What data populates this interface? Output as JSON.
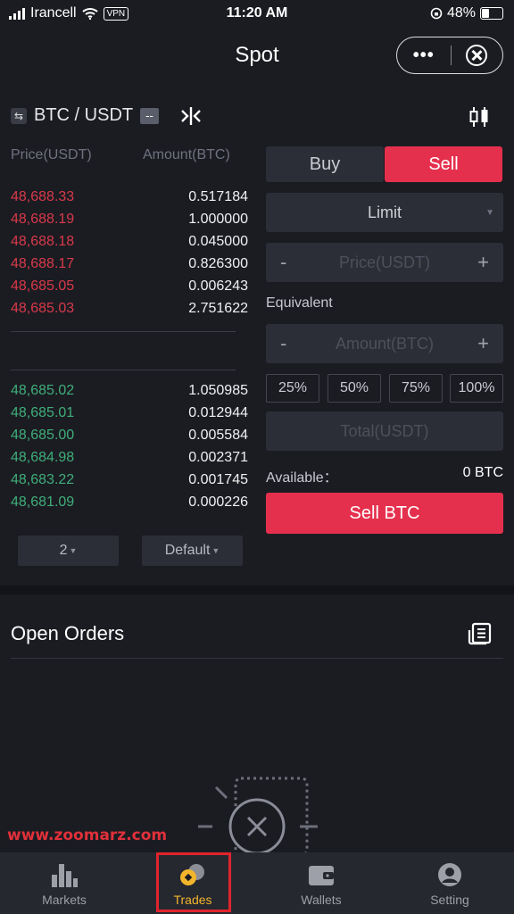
{
  "status_bar": {
    "carrier": "Irancell",
    "vpn": "VPN",
    "time": "11:20 AM",
    "battery": "48%"
  },
  "header": {
    "title": "Spot",
    "more_icon": "more-dots-icon",
    "close_icon": "close-circle-icon"
  },
  "pair": {
    "symbol": "BTC / USDT",
    "badge": "--"
  },
  "orderbook": {
    "price_header": "Price(USDT)",
    "amount_header": "Amount(BTC)",
    "asks": [
      {
        "price": "48,688.33",
        "amount": "0.517184"
      },
      {
        "price": "48,688.19",
        "amount": "1.000000"
      },
      {
        "price": "48,688.18",
        "amount": "0.045000"
      },
      {
        "price": "48,688.17",
        "amount": "0.826300"
      },
      {
        "price": "48,685.05",
        "amount": "0.006243"
      },
      {
        "price": "48,685.03",
        "amount": "2.751622"
      }
    ],
    "bids": [
      {
        "price": "48,685.02",
        "amount": "1.050985"
      },
      {
        "price": "48,685.01",
        "amount": "0.012944"
      },
      {
        "price": "48,685.00",
        "amount": "0.005584"
      },
      {
        "price": "48,684.98",
        "amount": "0.002371"
      },
      {
        "price": "48,683.22",
        "amount": "0.001745"
      },
      {
        "price": "48,681.09",
        "amount": "0.000226"
      }
    ],
    "depth_select": "2",
    "view_select": "Default"
  },
  "form": {
    "buy_tab": "Buy",
    "sell_tab": "Sell",
    "order_type": "Limit",
    "minus": "-",
    "plus": "+",
    "price_placeholder": "Price(USDT)",
    "equivalent_label": "Equivalent",
    "amount_placeholder": "Amount(BTC)",
    "percents": [
      "25%",
      "50%",
      "75%",
      "100%"
    ],
    "total_placeholder": "Total(USDT)",
    "available_label": "Available：",
    "available_value": "0 BTC",
    "submit_label": "Sell BTC"
  },
  "open_orders": {
    "title": "Open Orders"
  },
  "watermark": "www.zoomarz.com",
  "nav": [
    {
      "label": "Markets",
      "icon": "markets-bars-icon"
    },
    {
      "label": "Trades",
      "icon": "trades-coins-icon"
    },
    {
      "label": "Wallets",
      "icon": "wallet-icon"
    },
    {
      "label": "Setting",
      "icon": "user-circle-icon"
    }
  ],
  "colors": {
    "sell": "#e5304d",
    "ask": "#d8394a",
    "bid": "#3fae7a",
    "active_nav": "#f3b52c",
    "highlight_box": "#e0242c",
    "watermark": "#e0303a"
  }
}
